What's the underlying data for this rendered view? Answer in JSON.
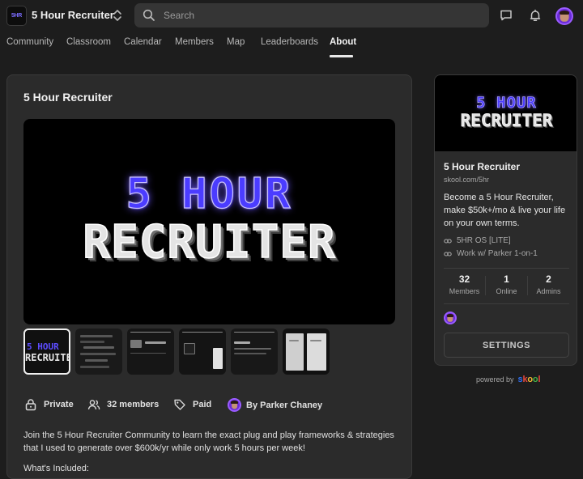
{
  "header": {
    "logo_text": "5HR",
    "brand": "5 Hour Recruiter",
    "search_placeholder": "Search"
  },
  "tabs": [
    "Community",
    "Classroom",
    "Calendar",
    "Members",
    "Map",
    "Leaderboards",
    "About"
  ],
  "active_tab": "About",
  "main": {
    "title": "5 Hour Recruiter",
    "hero_line1": "5 HOUR",
    "hero_line2": "RECRUITER",
    "thumb_line1": "5 HOUR",
    "thumb_line2": "RECRUITER",
    "meta": {
      "privacy": "Private",
      "members": "32 members",
      "pricing": "Paid",
      "owner": "By Parker Chaney"
    },
    "description": "Join the 5 Hour Recruiter Community to learn the exact plug and play frameworks & strategies that I used to generate over $600k/yr while only work 5 hours per week!",
    "included_heading": "What's Included:"
  },
  "sidebar": {
    "banner_line1": "5 HOUR",
    "banner_line2": "RECRUITER",
    "name": "5 Hour Recruiter",
    "url": "skool.com/5hr",
    "description": "Become a 5 Hour Recruiter, make $50k+/mo & live your life on your own terms.",
    "links": [
      "5HR OS [LITE]",
      "Work w/ Parker 1-on-1"
    ],
    "stats": [
      {
        "value": "32",
        "label": "Members"
      },
      {
        "value": "1",
        "label": "Online"
      },
      {
        "value": "2",
        "label": "Admins"
      }
    ],
    "settings_label": "SETTINGS"
  },
  "footer": {
    "powered_by": "powered by",
    "skool_letters": [
      "s",
      "k",
      "o",
      "o",
      "l"
    ]
  },
  "colors": {
    "background": "#1d1d1d",
    "card": "#2b2b2b",
    "accent_purple": "#6a2bd8",
    "skool_s": "#2e6ff2",
    "skool_k": "#e8483d",
    "skool_o1": "#f2b632",
    "skool_o2": "#43b048",
    "skool_l": "#e8483d"
  }
}
